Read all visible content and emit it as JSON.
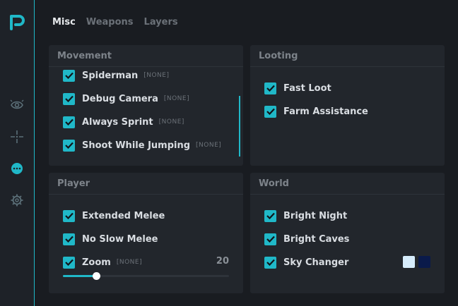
{
  "sidebar": {
    "logo": "P",
    "items": [
      {
        "icon": "eye-icon",
        "active": false
      },
      {
        "icon": "crosshair-icon",
        "active": false
      },
      {
        "icon": "more-dots-icon",
        "active": true
      },
      {
        "icon": "gear-icon",
        "active": false
      }
    ],
    "accent": "#20b8c8"
  },
  "tabs": [
    {
      "label": "Misc",
      "active": true
    },
    {
      "label": "Weapons",
      "active": false
    },
    {
      "label": "Layers",
      "active": false
    }
  ],
  "movement": {
    "title": "Movement",
    "items": [
      {
        "label": "Spiderman",
        "bind": "[NONE]",
        "checked": true
      },
      {
        "label": "Debug Camera",
        "bind": "[NONE]",
        "checked": true
      },
      {
        "label": "Always Sprint",
        "bind": "[NONE]",
        "checked": true
      },
      {
        "label": "Shoot While Jumping",
        "bind": "[NONE]",
        "checked": true
      }
    ]
  },
  "looting": {
    "title": "Looting",
    "items": [
      {
        "label": "Fast Loot",
        "checked": true
      },
      {
        "label": "Farm Assistance",
        "checked": true
      }
    ]
  },
  "player": {
    "title": "Player",
    "items": [
      {
        "label": "Extended Melee",
        "checked": true
      },
      {
        "label": "No Slow Melee",
        "checked": true
      }
    ],
    "zoom": {
      "label": "Zoom",
      "bind": "[NONE]",
      "checked": true,
      "value": "20",
      "fraction": 0.2
    }
  },
  "world": {
    "title": "World",
    "items": [
      {
        "label": "Bright Night",
        "checked": true
      },
      {
        "label": "Bright Caves",
        "checked": true
      },
      {
        "label": "Sky Changer",
        "checked": true
      }
    ],
    "sky_colors": [
      "#d6ecfb",
      "#0a1a4a"
    ]
  }
}
